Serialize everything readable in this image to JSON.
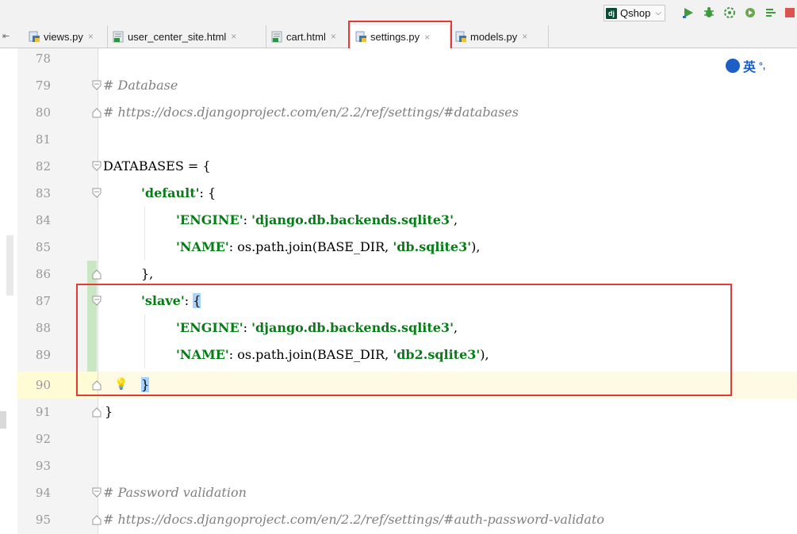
{
  "toolbar": {
    "run_config": {
      "badge": "dj",
      "label": "Qshop"
    }
  },
  "tabs": [
    {
      "label": "views.py",
      "type": "py"
    },
    {
      "label": "user_center_site.html",
      "type": "html"
    },
    {
      "label": "cart.html",
      "type": "html"
    },
    {
      "label": "settings.py",
      "type": "py",
      "active": true
    },
    {
      "label": "models.py",
      "type": "py"
    }
  ],
  "ime": {
    "label": "英",
    "extra": "°,"
  },
  "editor": {
    "lines": [
      {
        "n": "78"
      },
      {
        "n": "79"
      },
      {
        "n": "80"
      },
      {
        "n": "81"
      },
      {
        "n": "82"
      },
      {
        "n": "83"
      },
      {
        "n": "84"
      },
      {
        "n": "85"
      },
      {
        "n": "86"
      },
      {
        "n": "87"
      },
      {
        "n": "88"
      },
      {
        "n": "89"
      },
      {
        "n": "90"
      },
      {
        "n": "91"
      },
      {
        "n": "92"
      },
      {
        "n": "93"
      },
      {
        "n": "94"
      },
      {
        "n": "95"
      }
    ],
    "code": {
      "l79": "# Database",
      "l80": "# https://docs.djangoproject.com/en/2.2/ref/settings/#databases",
      "l82": "DATABASES = {",
      "l83_key": "'default'",
      "l83_rest": ": {",
      "l84_key": "'ENGINE'",
      "l84_sep": ": ",
      "l84_val": "'django.db.backends.sqlite3'",
      "l84_end": ",",
      "l85_key": "'NAME'",
      "l85_mid": ": os.path.join(BASE_DIR, ",
      "l85_val": "'db.sqlite3'",
      "l85_end": "),",
      "l86": "},",
      "l87_key": "'slave'",
      "l87_sep": ": ",
      "l87_brace": "{",
      "l88_key": "'ENGINE'",
      "l88_sep": ": ",
      "l88_val": "'django.db.backends.sqlite3'",
      "l88_end": ",",
      "l89_key": "'NAME'",
      "l89_mid": ": os.path.join(BASE_DIR, ",
      "l89_val": "'db2.sqlite3'",
      "l89_end": "),",
      "l90": "}",
      "l91": "}",
      "l94": "# Password validation",
      "l95": "# https://docs.djangoproject.com/en/2.2/ref/settings/#auth-password-validato"
    }
  },
  "colors": {
    "annotation_red": "#e53935",
    "string_green": "#067d17",
    "comment_gray": "#808080",
    "caret_line": "#fffae3"
  }
}
